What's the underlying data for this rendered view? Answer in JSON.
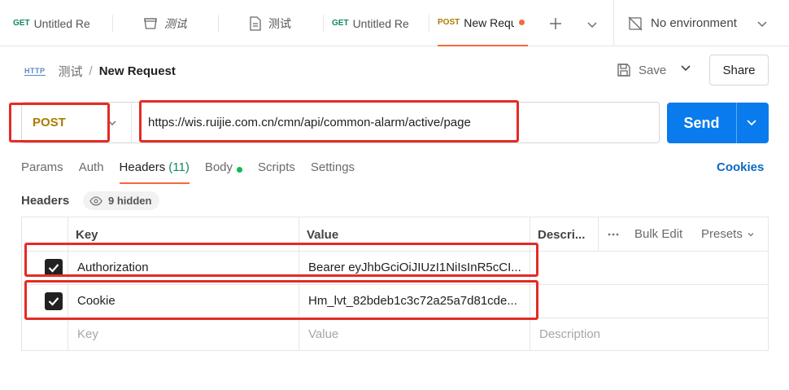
{
  "tabs": [
    {
      "method": "GET",
      "title": "Untitled Re",
      "type": "request"
    },
    {
      "title": "测试",
      "type": "collection"
    },
    {
      "title": "测试",
      "type": "document"
    },
    {
      "method": "GET",
      "title": "Untitled Re",
      "type": "request"
    },
    {
      "method": "POST",
      "title": "New Requ",
      "type": "request",
      "active": true,
      "unsaved": true
    }
  ],
  "environment": {
    "label": "No environment"
  },
  "breadcrumb": {
    "icon_text": "HTTP",
    "parent": "测试",
    "separator": "/",
    "current": "New Request"
  },
  "actions": {
    "save": "Save",
    "share": "Share"
  },
  "request": {
    "method": "POST",
    "url": "https://wis.ruijie.com.cn/cmn/api/common-alarm/active/page",
    "send": "Send"
  },
  "request_tabs": {
    "params": "Params",
    "auth": "Auth",
    "headers": "Headers",
    "headers_count": "(11)",
    "body": "Body",
    "scripts": "Scripts",
    "settings": "Settings"
  },
  "cookies": "Cookies",
  "headers_section": {
    "label": "Headers",
    "hidden": "9 hidden"
  },
  "table": {
    "columns": {
      "key": "Key",
      "value": "Value",
      "description": "Descri...",
      "bulk_edit": "Bulk Edit",
      "presets": "Presets"
    },
    "rows": [
      {
        "key": "Authorization",
        "value": "Bearer eyJhbGciOiJIUzI1NiIsInR5cCI...",
        "checked": true
      },
      {
        "key": "Cookie",
        "value": "Hm_lvt_82bdeb1c3c72a25a7d81cde...",
        "checked": true
      }
    ],
    "placeholder": {
      "key": "Key",
      "value": "Value",
      "description": "Description"
    }
  },
  "colors": {
    "accent": "#f26b3a",
    "send": "#097bed",
    "post": "#ad7a03",
    "get": "#0f8a59",
    "annotation": "#e52b25"
  }
}
